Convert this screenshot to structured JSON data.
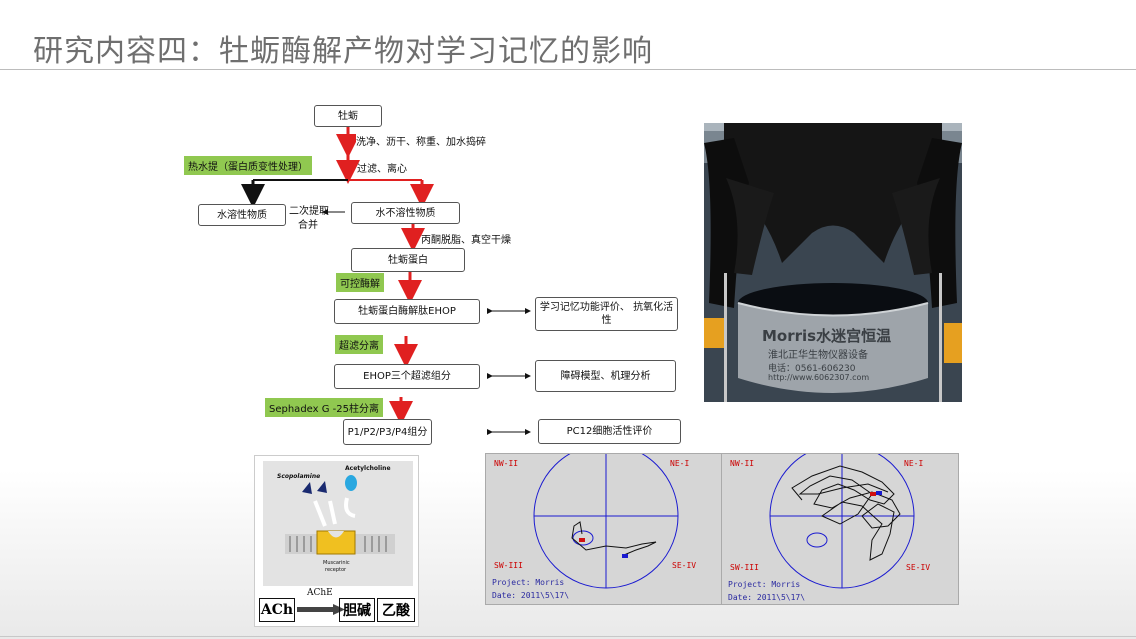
{
  "title": "研究内容四：牡蛎酶解产物对学习记忆的影响",
  "flow": {
    "start": "牡蛎",
    "step_wash": "洗净、沥干、称重、加水捣碎",
    "hot_water": "热水提（蛋白质变性处理）",
    "step_filter": "过滤、离心",
    "soluble": "水溶性物质",
    "combine_line1": "二次提取",
    "combine_line2": "合并",
    "insoluble": "水不溶性物质",
    "step_degrease": "丙酮脱脂、真空干燥",
    "protein": "牡蛎蛋白",
    "enzymolysis": "可控酶解",
    "ehop": "牡蛎蛋白酶解肽EHOP",
    "eval1": "学习记忆功能评价、 抗氧化活性",
    "ultrafiltration": "超滤分离",
    "ehop3": "EHOP三个超滤组分",
    "eval2": "障碍模型、机理分析",
    "sephadex": "Sephadex G -25柱分离",
    "fractions": "P1/P2/P3/P4组分",
    "eval3": "PC12细胞活性评价"
  },
  "receptor": {
    "scopolamine": "Scopolamine",
    "acetylcholine": "Acetylcholine",
    "receptor_label_1": "Muscarinic",
    "receptor_label_2": "receptor",
    "ache": "AChE",
    "ach": "ACh",
    "choline": "胆碱",
    "acetic": "乙酸"
  },
  "photo": {
    "sign_line1": "Morris水迷宫恒温",
    "sign_line2": "淮北正华生物仪器设备",
    "sign_line3": "电话：0561-606230",
    "sign_line4": "http://www.6062307.com"
  },
  "tracks": [
    {
      "nw": "NW-II",
      "ne": "NE-I",
      "sw": "SW-III",
      "se": "SE-IV",
      "project": "Project: Morris",
      "date": "Date: 2011\\5\\17\\"
    },
    {
      "nw": "NW-II",
      "ne": "NE-I",
      "sw": "SW-III",
      "se": "SE-IV",
      "project": "Project: Morris",
      "date": "Date: 2011\\5\\17\\"
    }
  ],
  "colors": {
    "accent_green": "#90c850",
    "arrow_red": "#e02020",
    "title_gray": "#6f6f6f",
    "track_blue": "#1a1ad0"
  }
}
